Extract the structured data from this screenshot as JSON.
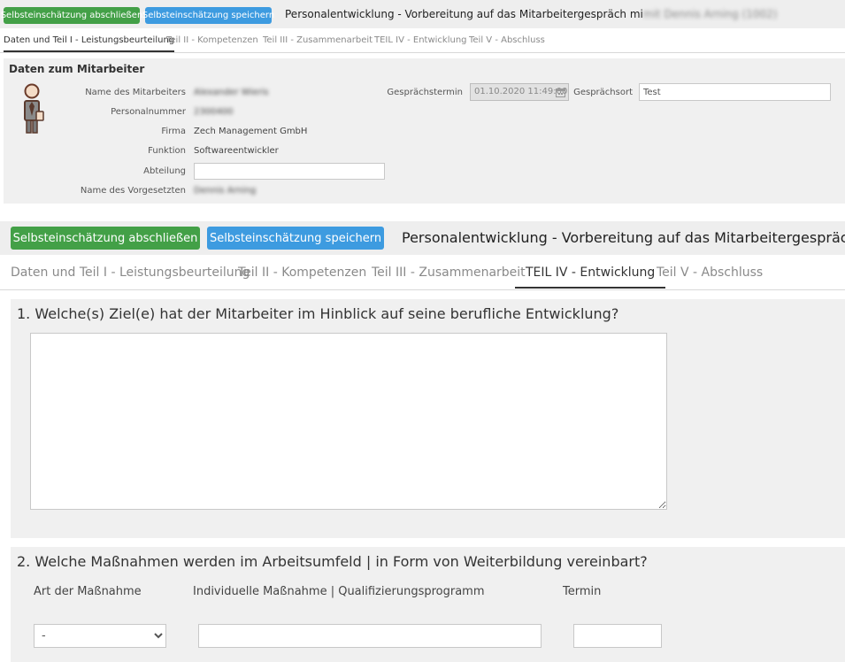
{
  "toolbar": {
    "finish_label": "Selbsteinschätzung abschließen",
    "save_label": "Selbsteinschätzung speichern",
    "title": "Personalentwicklung - Vorbereitung auf das Mitarbeitergespräch",
    "title_suffix_top": "mit Dennis Arning (1002)",
    "title_top_prefix": "Personalentwicklung - Vorbereitung auf das Mitarbeitergespräch mi"
  },
  "tabs_top": [
    {
      "label": "Daten und Teil I - Leistungsbeurteilung",
      "active": true
    },
    {
      "label": "Teil II - Kompetenzen",
      "active": false
    },
    {
      "label": "Teil III - Zusammenarbeit",
      "active": false
    },
    {
      "label": "TEIL IV - Entwicklung",
      "active": false
    },
    {
      "label": "Teil V - Abschluss",
      "active": false
    }
  ],
  "tabs_bottom": [
    {
      "label": "Daten und Teil I - Leistungsbeurteilung",
      "active": false
    },
    {
      "label": "Teil II - Kompetenzen",
      "active": false
    },
    {
      "label": "Teil III - Zusammenarbeit",
      "active": false
    },
    {
      "label": "TEIL IV - Entwicklung",
      "active": true
    },
    {
      "label": "Teil V - Abschluss",
      "active": false
    }
  ],
  "employee": {
    "section_title": "Daten zum Mitarbeiter",
    "name_label": "Name des Mitarbeiters",
    "name_value": "Alexander Wieris",
    "personnel_label": "Personalnummer",
    "personnel_value": "2300400",
    "company_label": "Firma",
    "company_value": "Zech Management GmbH",
    "function_label": "Funktion",
    "function_value": "Softwareentwickler",
    "department_label": "Abteilung",
    "department_value": "",
    "supervisor_label": "Name des Vorgesetzten",
    "supervisor_value": "Dennis Arning",
    "date_label": "Gesprächstermin",
    "date_value": "01.10.2020 11:49:00",
    "location_label": "Gesprächsort",
    "location_value": "Test"
  },
  "q1": {
    "title": "1. Welche(s) Ziel(e) hat der Mitarbeiter im Hinblick auf seine berufliche Entwicklung?",
    "answer": ""
  },
  "q2": {
    "title": "2. Welche Maßnahmen werden im Arbeitsumfeld | in Form von Weiterbildung vereinbart?",
    "col_type": "Art der Maßnahme",
    "col_individual": "Individuelle Maßnahme | Qualifizierungsprogramm",
    "col_date": "Termin",
    "type_selected": "-",
    "individual_value": "",
    "date_value": ""
  },
  "colors": {
    "green": "#43a047",
    "blue": "#3d9be0",
    "panel": "#f0f0f0"
  }
}
